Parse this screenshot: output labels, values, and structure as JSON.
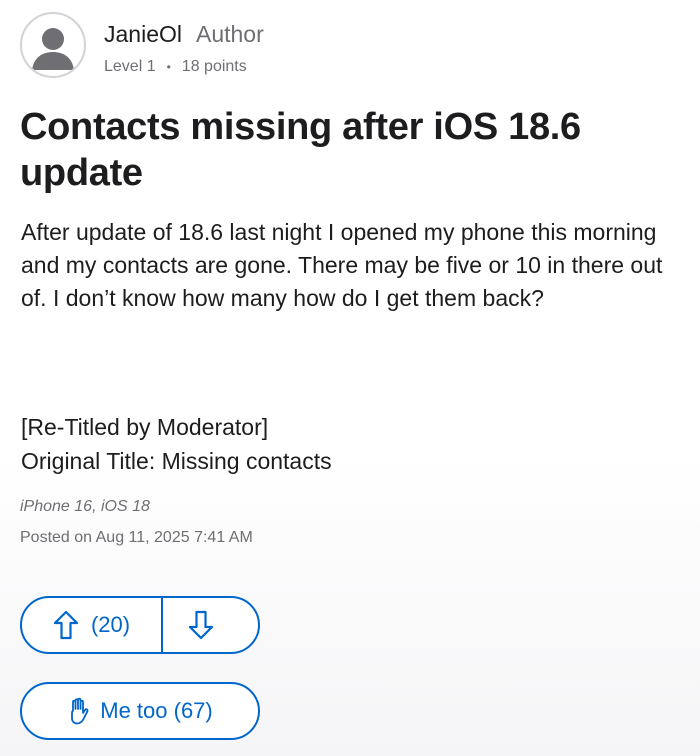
{
  "author": {
    "name": "JanieOl",
    "role": "Author",
    "level": "Level 1",
    "separator": "•",
    "points": "18 points",
    "avatar_icon": "person-silhouette-icon"
  },
  "post": {
    "title": "Contacts missing after iOS 18.6 update",
    "body": "After update of 18.6 last night I opened my phone this morning and my contacts are gone. There may be five or 10 in there out of. I don’t know how many how do I get them back?",
    "moderator_note_line1": "[Re-Titled by Moderator]",
    "moderator_note_line2": "Original Title: Missing contacts",
    "device": "iPhone 16, iOS 18",
    "posted": "Posted on Aug 11, 2025 7:41 AM"
  },
  "actions": {
    "upvote_count": "(20)",
    "upvote_icon": "arrow-up-icon",
    "downvote_icon": "arrow-down-icon",
    "metoo_label": "Me too (67)",
    "metoo_icon": "raised-hand-icon"
  },
  "colors": {
    "accent": "#0066cc",
    "text": "#1d1d1f",
    "secondary": "#6e6e73"
  }
}
